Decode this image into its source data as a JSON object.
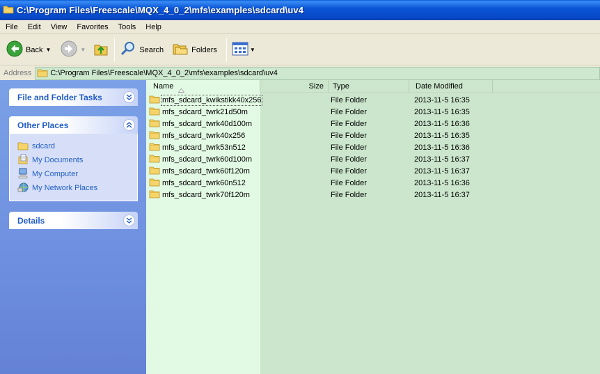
{
  "window": {
    "title": "C:\\Program Files\\Freescale\\MQX_4_0_2\\mfs\\examples\\sdcard\\uv4"
  },
  "menu": [
    "File",
    "Edit",
    "View",
    "Favorites",
    "Tools",
    "Help"
  ],
  "toolbar": {
    "back_label": "Back",
    "search_label": "Search",
    "folders_label": "Folders"
  },
  "address": {
    "label": "Address",
    "value": "C:\\Program Files\\Freescale\\MQX_4_0_2\\mfs\\examples\\sdcard\\uv4"
  },
  "left_pane": {
    "file_tasks_title": "File and Folder Tasks",
    "other_places_title": "Other Places",
    "other_places": [
      "sdcard",
      "My Documents",
      "My Computer",
      "My Network Places"
    ],
    "details_title": "Details"
  },
  "columns": {
    "name": "Name",
    "size": "Size",
    "type": "Type",
    "date": "Date Modified"
  },
  "files": [
    {
      "name": "mfs_sdcard_kwikstikk40x256",
      "type": "File Folder",
      "date": "2013-11-5 16:35"
    },
    {
      "name": "mfs_sdcard_twrk21d50m",
      "type": "File Folder",
      "date": "2013-11-5 16:35"
    },
    {
      "name": "mfs_sdcard_twrk40d100m",
      "type": "File Folder",
      "date": "2013-11-5 16:36"
    },
    {
      "name": "mfs_sdcard_twrk40x256",
      "type": "File Folder",
      "date": "2013-11-5 16:35"
    },
    {
      "name": "mfs_sdcard_twrk53n512",
      "type": "File Folder",
      "date": "2013-11-5 16:36"
    },
    {
      "name": "mfs_sdcard_twrk60d100m",
      "type": "File Folder",
      "date": "2013-11-5 16:37"
    },
    {
      "name": "mfs_sdcard_twrk60f120m",
      "type": "File Folder",
      "date": "2013-11-5 16:37"
    },
    {
      "name": "mfs_sdcard_twrk60n512",
      "type": "File Folder",
      "date": "2013-11-5 16:36"
    },
    {
      "name": "mfs_sdcard_twrk70f120m",
      "type": "File Folder",
      "date": "2013-11-5 16:37"
    }
  ],
  "colors": {
    "title_bar": "#0a56d6",
    "file_pane": "#cbe6cc",
    "name_column": "#e2f9e3",
    "left_pane": "#6e8fdf",
    "link": "#215dc6"
  }
}
